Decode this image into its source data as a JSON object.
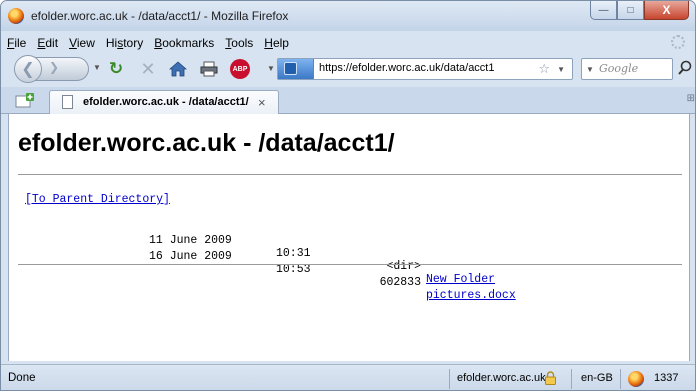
{
  "window": {
    "title": "efolder.worc.ac.uk - /data/acct1/ - Mozilla Firefox",
    "buttons": {
      "minimize": "—",
      "maximize": "□",
      "close": "X"
    }
  },
  "menu": [
    {
      "label": "File",
      "key": "F",
      "rest": "ile"
    },
    {
      "label": "Edit",
      "key": "E",
      "rest": "dit"
    },
    {
      "label": "View",
      "key": "V",
      "rest": "iew"
    },
    {
      "label": "History",
      "key": "s",
      "pre": "Hi",
      "rest": "tory"
    },
    {
      "label": "Bookmarks",
      "key": "B",
      "rest": "ookmarks"
    },
    {
      "label": "Tools",
      "key": "T",
      "rest": "ools"
    },
    {
      "label": "Help",
      "key": "H",
      "rest": "elp"
    }
  ],
  "navbar": {
    "url": "https://efolder.worc.ac.uk/data/acct1",
    "search_placeholder": "Google",
    "adblock_badge": "ABP"
  },
  "tab": {
    "label": "efolder.worc.ac.uk - /data/acct1/",
    "close": "×"
  },
  "page": {
    "heading": "efolder.worc.ac.uk - /data/acct1/",
    "parent_link": "[To Parent Directory]",
    "entries": [
      {
        "date": "11 June 2009",
        "time": "10:31",
        "size": "<dir>",
        "name": "New Folder"
      },
      {
        "date": "16 June 2009",
        "time": "10:53",
        "size": "602833",
        "name": "pictures.docx"
      }
    ]
  },
  "status": {
    "text": "Done",
    "domain": "efolder.worc.ac.uk",
    "language": "en-GB",
    "counter": "1337"
  },
  "colors": {
    "link": "#0000cc",
    "chrome": "#d7e3f1",
    "close_button": "#c7452e"
  }
}
